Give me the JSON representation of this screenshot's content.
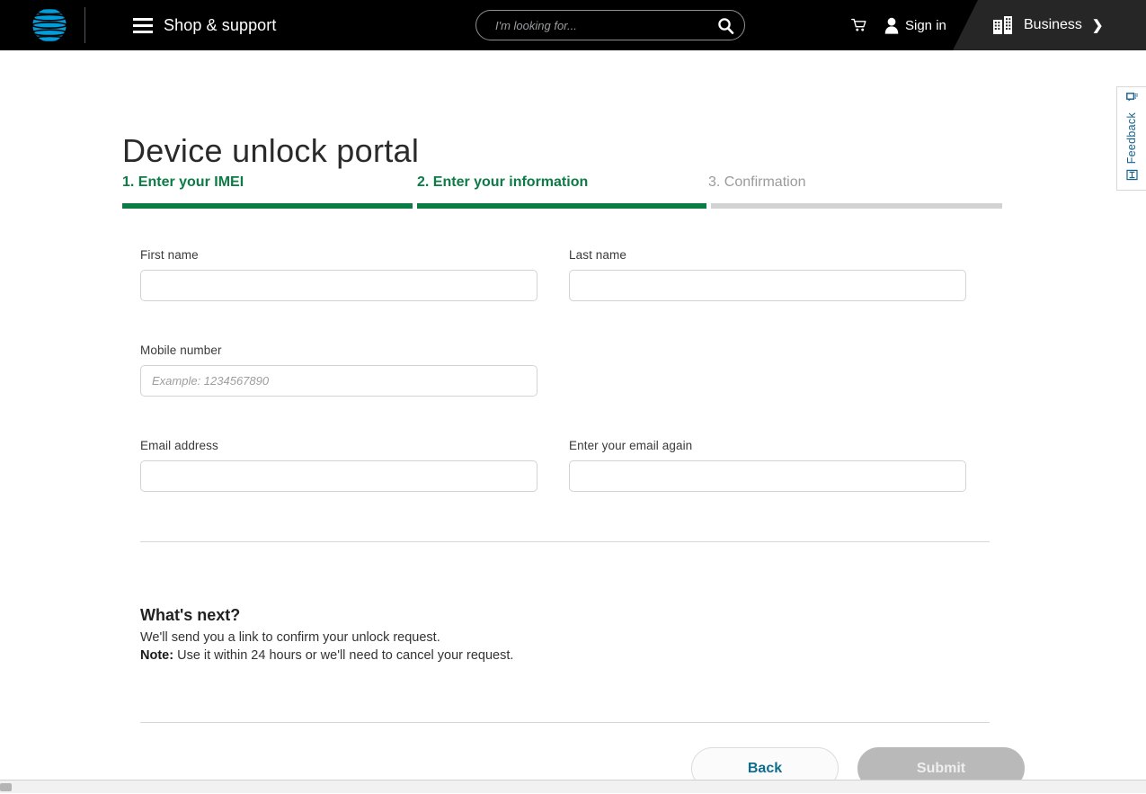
{
  "header": {
    "logo_name": "att-globe-logo",
    "menu_label": "Shop & support",
    "search": {
      "placeholder": "I'm looking for...",
      "value": ""
    },
    "cart_label": "cart",
    "signin_label": "Sign in",
    "business_label": "Business",
    "business_chevron": "❯"
  },
  "page": {
    "title": "Device unlock portal"
  },
  "steps": [
    {
      "label": "1. Enter your IMEI",
      "state": "complete"
    },
    {
      "label": "2. Enter your information",
      "state": "active"
    },
    {
      "label": "3. Confirmation",
      "state": "inactive"
    }
  ],
  "form": {
    "first_name": {
      "label": "First name",
      "value": "",
      "placeholder": ""
    },
    "last_name": {
      "label": "Last name",
      "value": "",
      "placeholder": ""
    },
    "mobile_number": {
      "label": "Mobile number",
      "value": "",
      "placeholder": "Example: 1234567890"
    },
    "email": {
      "label": "Email address",
      "value": "",
      "placeholder": ""
    },
    "email_confirm": {
      "label": "Enter your email again",
      "value": "",
      "placeholder": ""
    }
  },
  "whats_next": {
    "title": "What's next?",
    "line1": "We'll send you a link to confirm your unlock request.",
    "note_label": "Note:",
    "note_text": " Use it within 24 hours or we'll need to cancel your request."
  },
  "buttons": {
    "back": "Back",
    "submit": "Submit"
  },
  "feedback": {
    "label": "Feedback",
    "top_icon": "comment-icon",
    "bottom_icon": "expand-icon"
  },
  "colors": {
    "brand_blue": "#009FDB",
    "header_black": "#000000",
    "business_panel": "#262626",
    "step_green": "#0D7B46",
    "step_grey": "#D2D2D2",
    "link_teal": "#0D6D8E",
    "feedback_blue": "#16628C",
    "disabled_grey": "#B9B9B9"
  }
}
